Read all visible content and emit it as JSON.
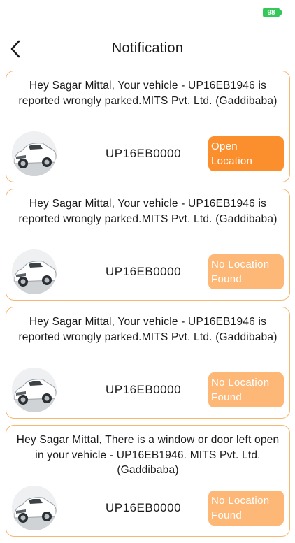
{
  "status_bar": {
    "battery": "98"
  },
  "header": {
    "title": "Notification",
    "back_icon": "chevron-left-icon"
  },
  "colors": {
    "accent": "#fb8f2d",
    "accent_light": "#fdb877",
    "card_border": "#f6b772",
    "battery": "#35c759"
  },
  "notifications": [
    {
      "message": "Hey Sagar Mittal, Your vehicle - UP16EB1946 is reported wrongly parked.MITS Pvt. Ltd. (Gaddibaba)",
      "plate": "UP16EB0000",
      "button_label": "Open Location",
      "button_state": "active"
    },
    {
      "message": "Hey Sagar Mittal, Your vehicle - UP16EB1946 is reported wrongly parked.MITS Pvt. Ltd. (Gaddibaba)",
      "plate": "UP16EB0000",
      "button_label": "No Location Found",
      "button_state": "disabled"
    },
    {
      "message": "Hey Sagar Mittal, Your vehicle - UP16EB1946 is reported wrongly parked.MITS Pvt. Ltd. (Gaddibaba)",
      "plate": "UP16EB0000",
      "button_label": "No Location Found",
      "button_state": "disabled"
    },
    {
      "message": "Hey Sagar Mittal, There is a window or door left open in your vehicle - UP16EB1946. MITS Pvt. Ltd. (Gaddibaba)",
      "plate": "UP16EB0000",
      "button_label": "No Location Found",
      "button_state": "disabled"
    }
  ]
}
